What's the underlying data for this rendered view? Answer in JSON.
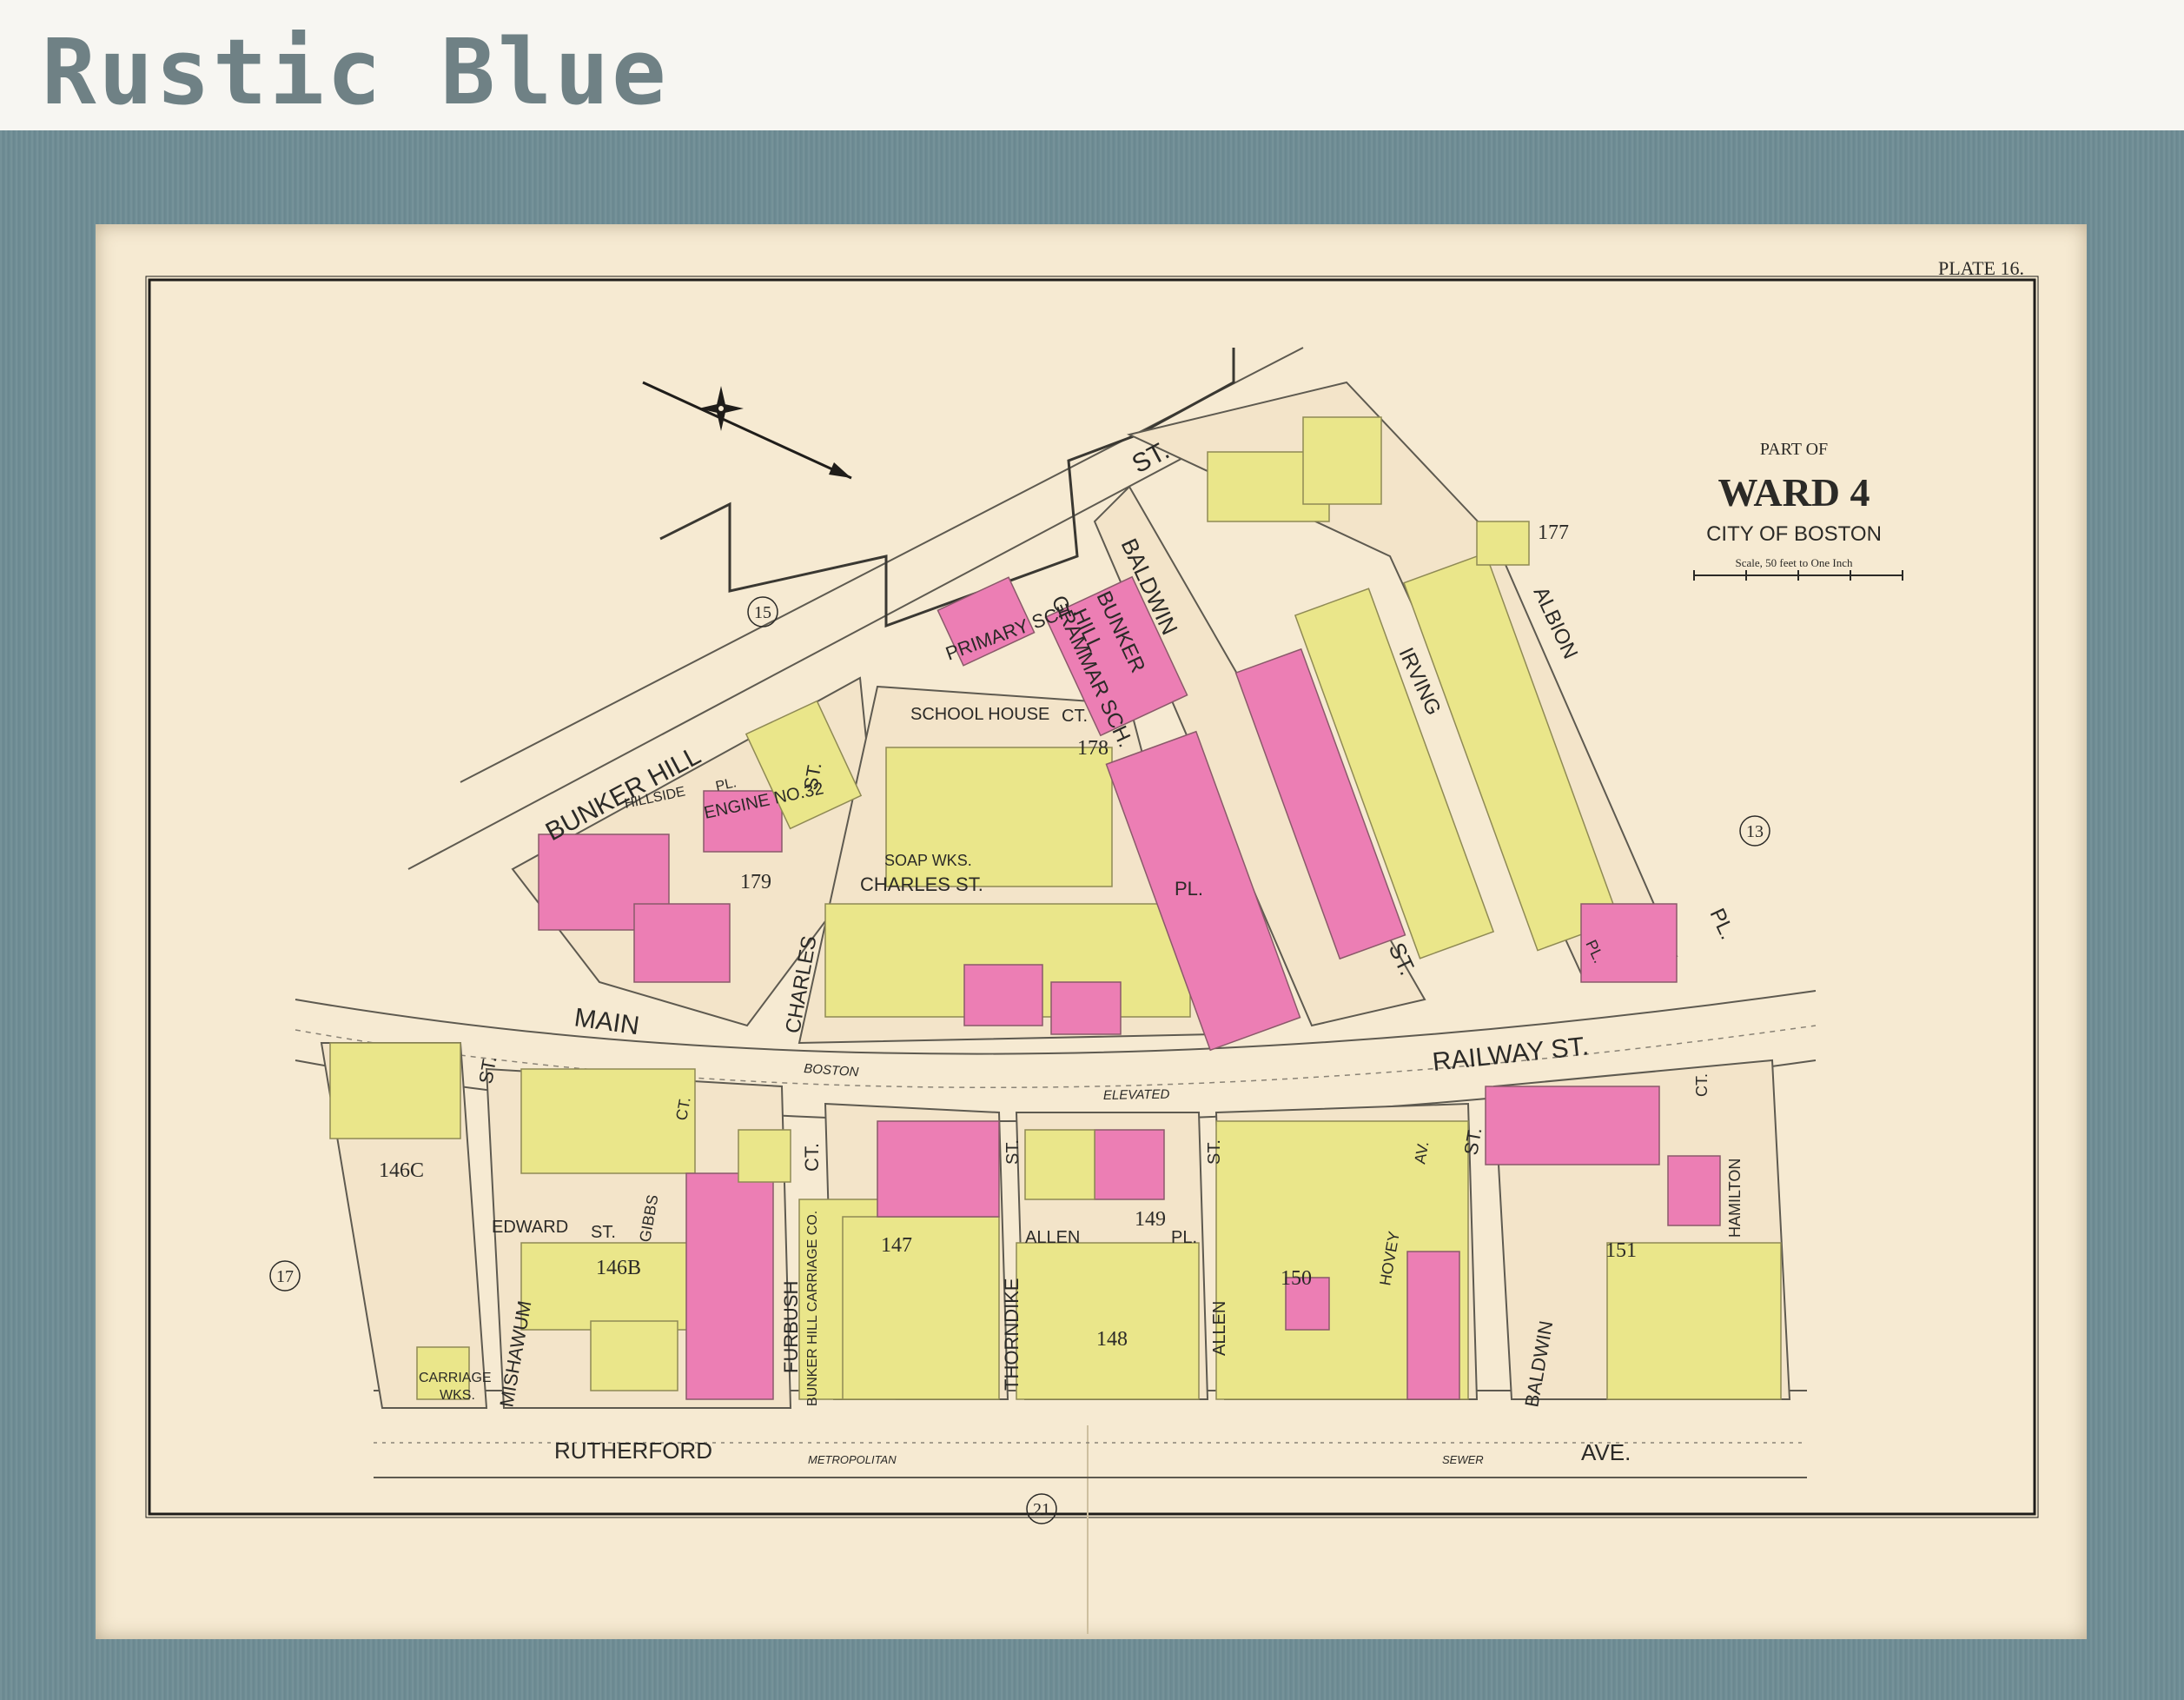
{
  "brand": "Rustic Blue",
  "plate": "PLATE 16.",
  "title": {
    "part_of": "PART OF",
    "ward": "WARD 4",
    "city": "CITY OF BOSTON",
    "scale": "Scale, 50 feet to One Inch"
  },
  "streets": {
    "bunker_hill_st": "BUNKER HILL",
    "st_top": "ST.",
    "main_st": "MAIN",
    "railway_st": "RAILWAY ST.",
    "boston": "BOSTON",
    "elevated": "ELEVATED",
    "rutherford": "RUTHERFORD",
    "metropolitan": "METROPOLITAN",
    "sewer": "SEWER",
    "ave": "AVE.",
    "baldwin_top": "BALDWIN",
    "baldwin_bottom": "BALDWIN",
    "st_baldwin": "ST.",
    "irving": "IRVING",
    "albion": "ALBION",
    "albion_pl": "PL.",
    "school_house_ct": "SCHOOL HOUSE",
    "ct_school": "CT.",
    "charles_st_pl": "CHARLES ST.",
    "pl_charles": "PL.",
    "charles_st": "CHARLES",
    "st_charles": "ST.",
    "hillside_pl": "HILLSIDE",
    "pl_hillside": "PL.",
    "mishawum": "MISHAWUM",
    "st_mishawum": "ST.",
    "edward_st": "EDWARD",
    "st_edward": "ST.",
    "gibbs_ct": "GIBBS",
    "ct_gibbs": "CT.",
    "furbush": "FURBUSH",
    "ct_furbush": "CT.",
    "thorndike": "THORNDIKE",
    "st_thorndike": "ST.",
    "allen_pl": "ALLEN",
    "pl_allen": "PL.",
    "allen_st": "ALLEN",
    "st_allen": "ST.",
    "hovey": "HOVEY",
    "av_hovey": "AV.",
    "st_right": "ST.",
    "hamilton": "HAMILTON",
    "ct_hamilton": "CT.",
    "pl_small": "PL."
  },
  "buildings": {
    "primary_sch": "PRIMARY SCH.",
    "bunker_hill_grammar_1": "BUNKER",
    "bunker_hill_grammar_2": "HILL",
    "bunker_hill_grammar_3": "GRAMMAR SCH.",
    "engine_1": "ENGINE NO.32",
    "soap_wks": "SOAP WKS.",
    "carriage_1": "CARRIAGE",
    "carriage_2": "WKS.",
    "bunker_hill_carriage": "BUNKER HILL CARRIAGE CO."
  },
  "block_numbers": [
    "177",
    "178",
    "179",
    "146C",
    "146B",
    "147",
    "148",
    "149",
    "150",
    "151"
  ],
  "adjacent_plates": [
    "15",
    "13",
    "17",
    "21"
  ]
}
